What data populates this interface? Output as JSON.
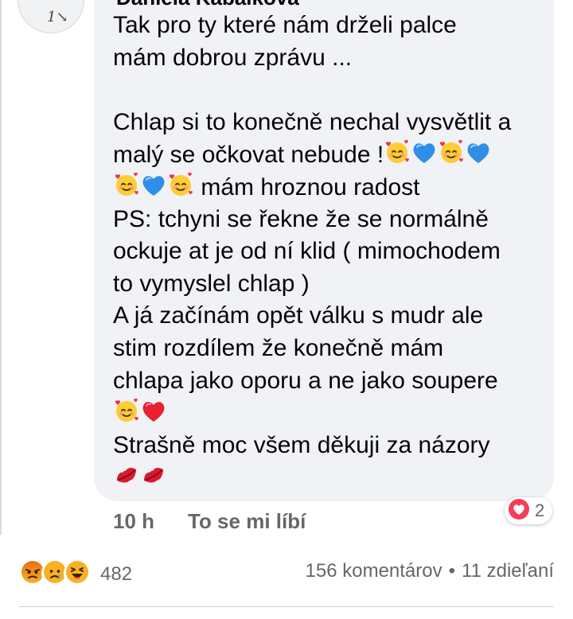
{
  "comment": {
    "author": "Daniela Kabalková",
    "lines": [
      [
        {
          "t": "Tak  pro ty které  nám drželi palce"
        }
      ],
      [
        {
          "t": "mám dobrou zprávu  ..."
        }
      ],
      [
        {
          "t": ""
        }
      ],
      [
        {
          "t": "Chlap si to konečně nechal vysvětlit a"
        }
      ],
      [
        {
          "t": "malý se očkovat nebude !"
        },
        {
          "e": "smiling-hearts"
        },
        {
          "e": "blue-heart"
        },
        {
          "e": "smiling-hearts"
        },
        {
          "e": "blue-heart"
        }
      ],
      [
        {
          "e": "smiling-hearts"
        },
        {
          "e": "blue-heart"
        },
        {
          "e": "smiling-hearts"
        },
        {
          "t": " mám hroznou radost"
        }
      ],
      [
        {
          "t": "PS: tchyni se řekne že  se normálně"
        }
      ],
      [
        {
          "t": "ockuje at je od ní klid ( mimochodem"
        }
      ],
      [
        {
          "t": "to vymyslel chlap )"
        }
      ],
      [
        {
          "t": "A já začínám opět válku s mudr ale"
        }
      ],
      [
        {
          "t": "stim rozdílem že konečně mám"
        }
      ],
      [
        {
          "t": "chlapa  jako oporu a ne jako soupere"
        }
      ],
      [
        {
          "e": "smiling-hearts"
        },
        {
          "e": "red-heart"
        }
      ],
      [
        {
          "t": "Strašně moc všem děkuji za názory"
        }
      ],
      [
        {
          "e": "kiss-mark"
        },
        {
          "e": "kiss-mark"
        }
      ]
    ],
    "time": "10 h",
    "like_label": "To se mi líbí",
    "reaction_count": "2",
    "reaction_icon": "love-reaction-icon"
  },
  "post": {
    "reactions": [
      "angry-reaction-icon",
      "sad-reaction-icon",
      "haha-reaction-icon"
    ],
    "reaction_total": "482",
    "comments": "156 komentárov",
    "separator": "•",
    "shares": "11 zdieľaní"
  },
  "colors": {
    "bubble": "#f0f2f5",
    "meta_text": "#65676b",
    "love_red": "#f33e58",
    "angry_orange": "#e9710f",
    "reaction_yellow": "#f7b125"
  }
}
